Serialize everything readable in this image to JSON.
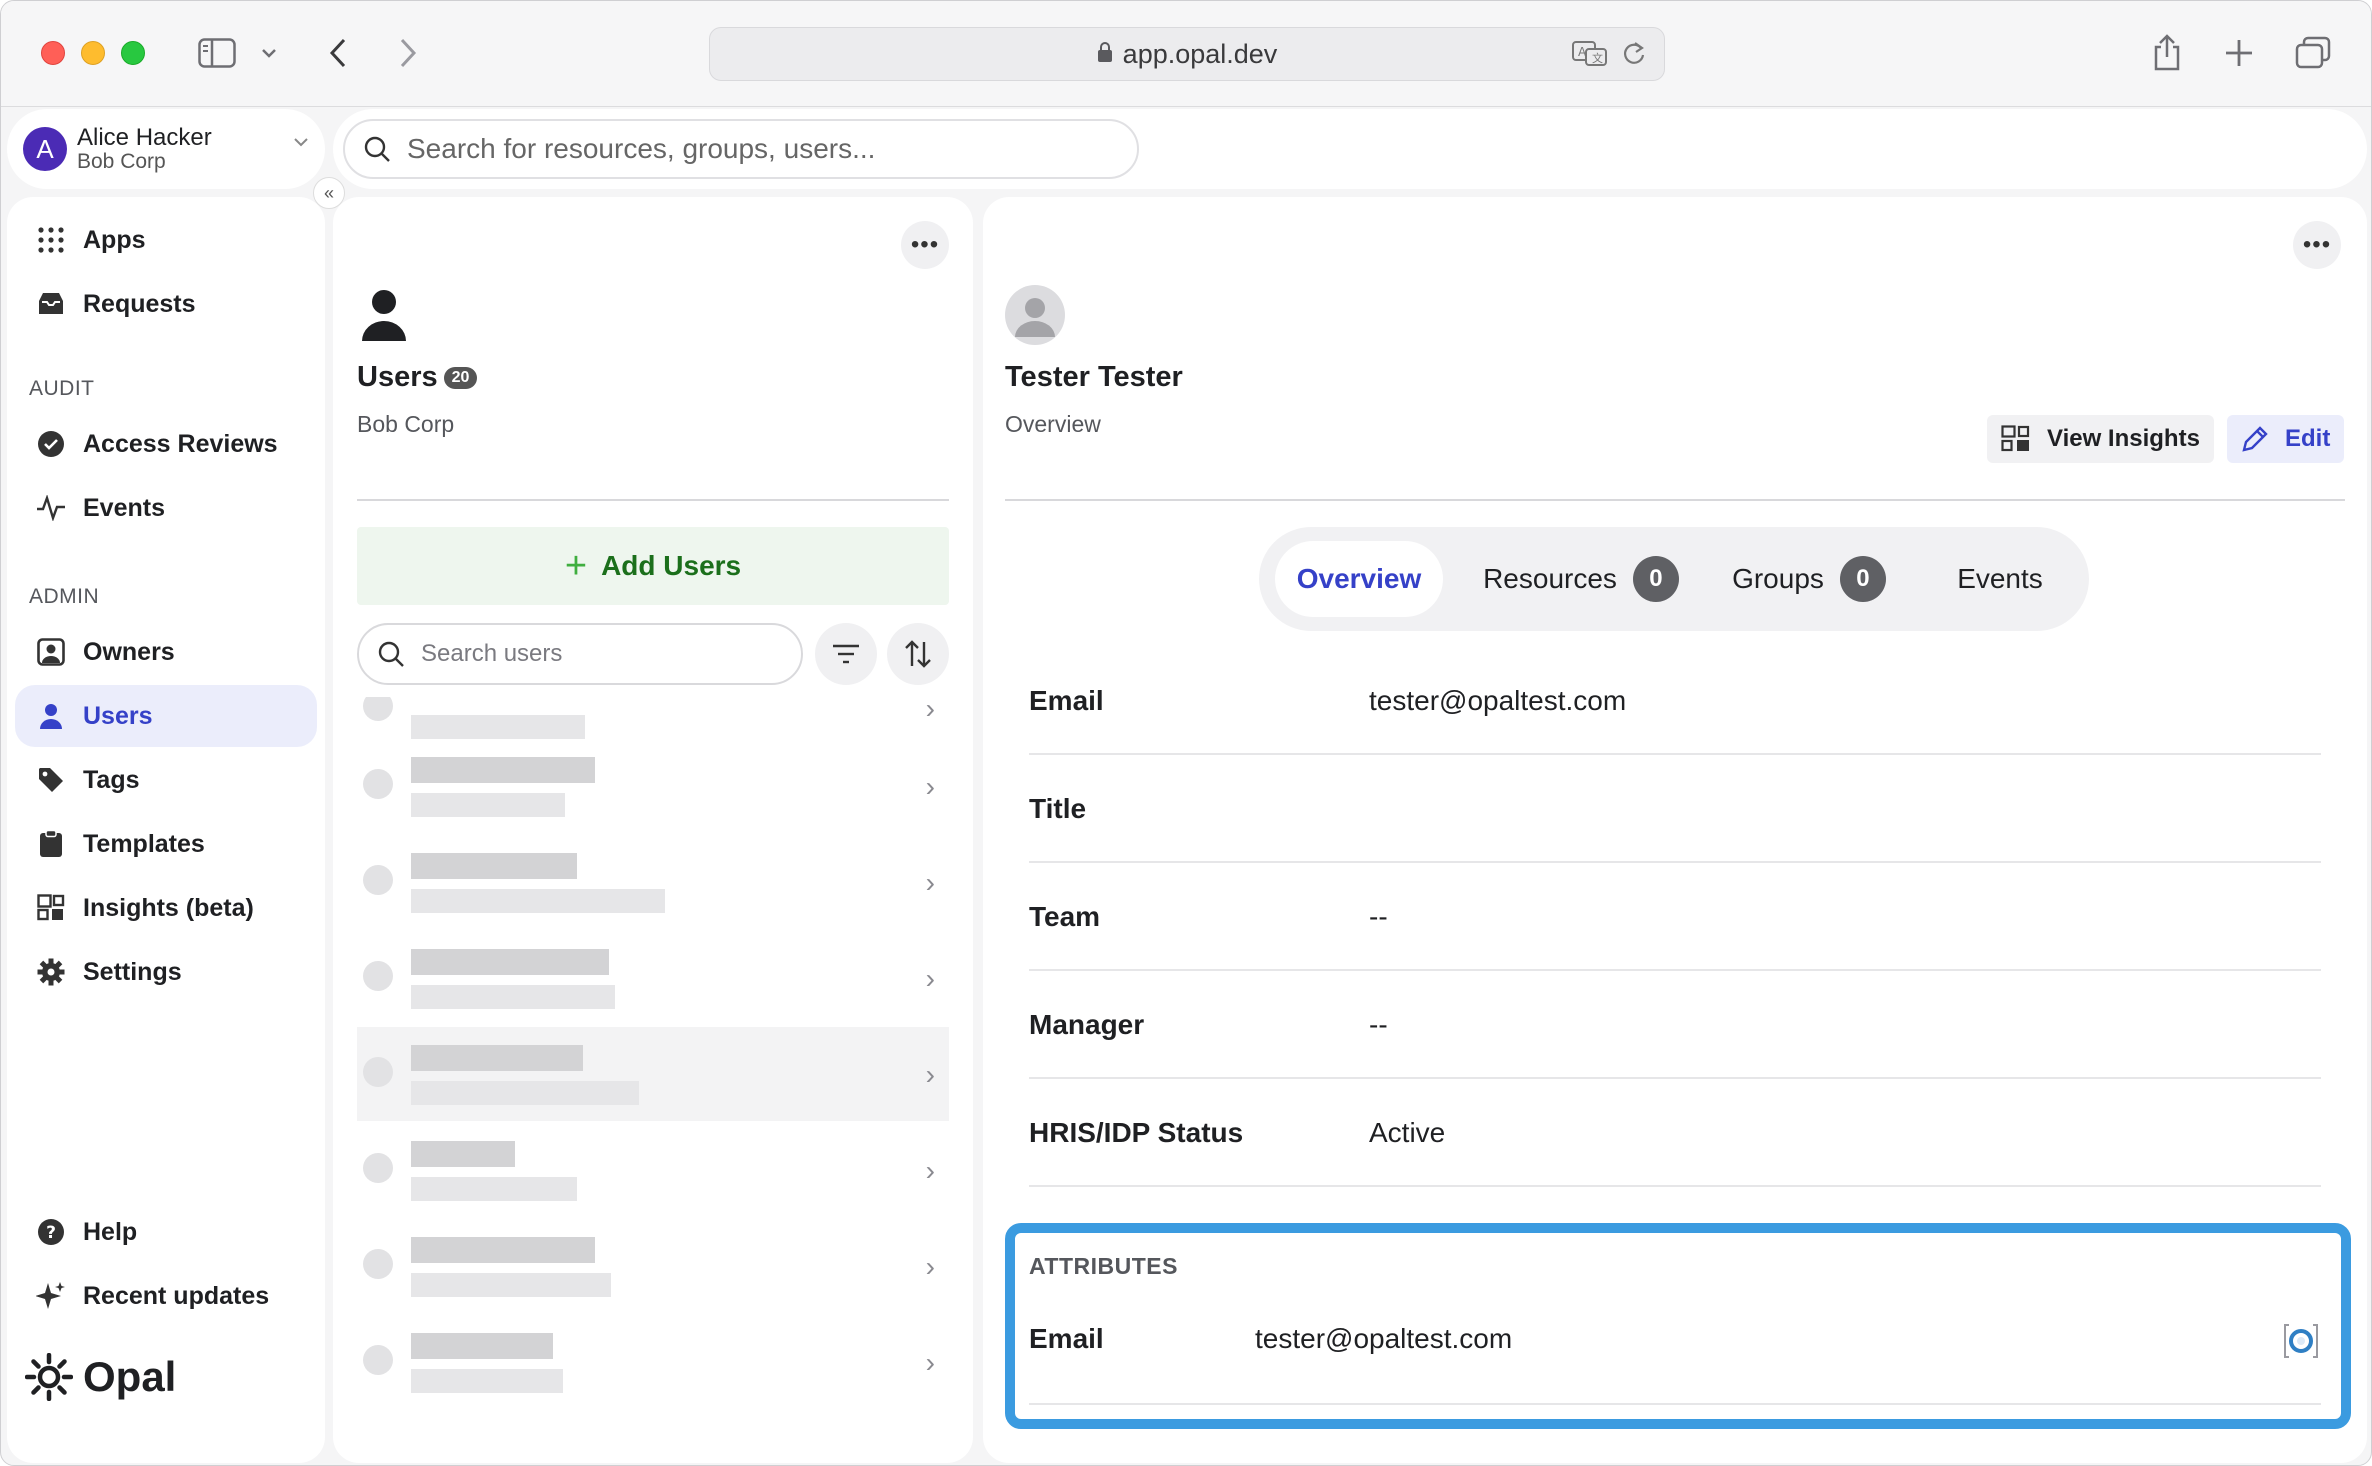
{
  "browser": {
    "url": "app.opal.dev"
  },
  "account": {
    "initial": "A",
    "name": "Alice Hacker",
    "org": "Bob Corp"
  },
  "global_search": {
    "placeholder": "Search for resources, groups, users..."
  },
  "sidebar": {
    "collapse_label": "«",
    "top_items": [
      {
        "label": "Apps",
        "icon": "grid-icon"
      },
      {
        "label": "Requests",
        "icon": "inbox-icon"
      }
    ],
    "audit_header": "AUDIT",
    "audit_items": [
      {
        "label": "Access Reviews",
        "icon": "check-circle-icon"
      },
      {
        "label": "Events",
        "icon": "activity-icon"
      }
    ],
    "admin_header": "ADMIN",
    "admin_items": [
      {
        "label": "Owners",
        "icon": "owner-icon"
      },
      {
        "label": "Users",
        "icon": "user-icon",
        "active": true
      },
      {
        "label": "Tags",
        "icon": "tag-icon"
      },
      {
        "label": "Templates",
        "icon": "clipboard-icon"
      },
      {
        "label": "Insights (beta)",
        "icon": "insights-icon"
      },
      {
        "label": "Settings",
        "icon": "gear-icon"
      }
    ],
    "bottom_items": [
      {
        "label": "Help",
        "icon": "help-icon"
      },
      {
        "label": "Recent updates",
        "icon": "sparkle-icon"
      }
    ],
    "logo_text": "Opal"
  },
  "users_panel": {
    "title": "Users",
    "count": "20",
    "subtitle": "Bob Corp",
    "add_button": "Add Users",
    "search_placeholder": "Search users"
  },
  "detail": {
    "name": "Tester Tester",
    "subtitle": "Overview",
    "view_insights": "View Insights",
    "edit": "Edit",
    "tabs": [
      {
        "label": "Overview",
        "active": true
      },
      {
        "label": "Resources",
        "count": "0"
      },
      {
        "label": "Groups",
        "count": "0"
      },
      {
        "label": "Events"
      }
    ],
    "fields": [
      {
        "label": "Email",
        "value": "tester@opaltest.com"
      },
      {
        "label": "Title",
        "value": ""
      },
      {
        "label": "Team",
        "value": "--"
      },
      {
        "label": "Manager",
        "value": "--"
      },
      {
        "label": "HRIS/IDP Status",
        "value": "Active"
      }
    ],
    "attributes": {
      "header": "ATTRIBUTES",
      "label": "Email",
      "value": "tester@opaltest.com"
    }
  },
  "colors": {
    "accent": "#3541c8",
    "highlight_border": "#3b9be0",
    "add_button_bg": "#eef6ee",
    "avatar": "#4b2bb5"
  }
}
